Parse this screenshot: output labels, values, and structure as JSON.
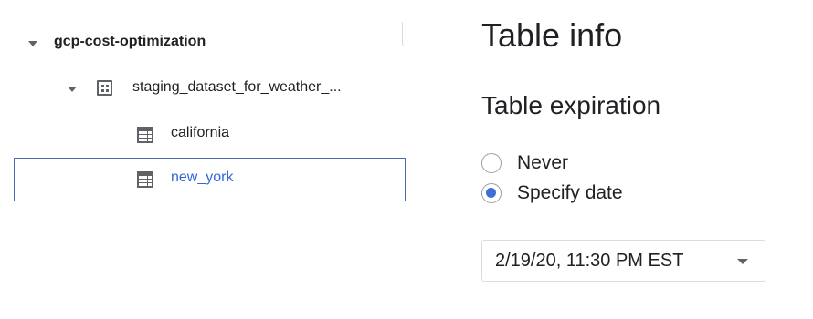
{
  "explorer": {
    "project": {
      "label": "gcp-cost-optimization",
      "icon": "caret-down-icon"
    },
    "dataset": {
      "label": "staging_dataset_for_weather_...",
      "icon": "dataset-icon",
      "expander_icon": "caret-down-icon"
    },
    "tables": [
      {
        "label": "california",
        "icon": "table-icon",
        "selected": false
      },
      {
        "label": "new_york",
        "icon": "table-icon",
        "selected": true
      }
    ]
  },
  "table_info": {
    "title": "Table info",
    "expiration": {
      "title": "Table expiration",
      "options": [
        {
          "label": "Never",
          "checked": false
        },
        {
          "label": "Specify date",
          "checked": true
        }
      ],
      "date_value": "2/19/20, 11:30 PM EST",
      "dropdown_icon": "dropdown-arrow-icon"
    }
  },
  "colors": {
    "selected_text": "#3367d6",
    "selected_border": "#4a6ab4",
    "radio_checked": "#3b6fd6",
    "text": "#202124",
    "icon_gray": "#5f6368"
  }
}
